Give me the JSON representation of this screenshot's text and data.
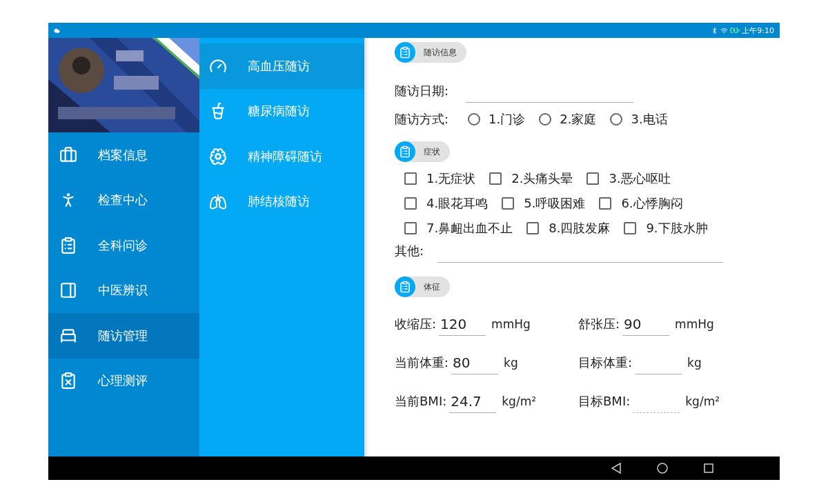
{
  "status_bar": {
    "time": "上午9:10"
  },
  "sidebar": {
    "items": [
      {
        "label": "档案信息",
        "selected": false
      },
      {
        "label": "检查中心",
        "selected": false
      },
      {
        "label": "全科问诊",
        "selected": false
      },
      {
        "label": "中医辨识",
        "selected": false
      },
      {
        "label": "随访管理",
        "selected": true
      },
      {
        "label": "心理测评",
        "selected": false
      }
    ]
  },
  "submenu": {
    "items": [
      {
        "label": "高血压随访",
        "selected": true
      },
      {
        "label": "糖尿病随访",
        "selected": false
      },
      {
        "label": "精神障碍随访",
        "selected": false
      },
      {
        "label": "肺结核随访",
        "selected": false
      }
    ]
  },
  "form": {
    "sections": [
      {
        "title": "随访信息",
        "kind": "visit",
        "date_label": "随访日期:",
        "method_label": "随访方式:",
        "options": [
          {
            "label": "1.门诊",
            "selected": false
          },
          {
            "label": "2.家庭",
            "selected": false
          },
          {
            "label": "3.电话",
            "selected": false
          }
        ]
      },
      {
        "title": "症状",
        "kind": "symptoms",
        "rows": [
          [
            {
              "label": "1.无症状",
              "checked": false
            },
            {
              "label": "2.头痛头晕",
              "checked": false
            },
            {
              "label": "3.恶心呕吐",
              "checked": false
            }
          ],
          [
            {
              "label": "4.眼花耳鸣",
              "checked": false
            },
            {
              "label": "5.呼吸困难",
              "checked": false
            },
            {
              "label": "6.心悸胸闷",
              "checked": false
            }
          ],
          [
            {
              "label": "7.鼻衄出血不止",
              "checked": false
            },
            {
              "label": "8.四肢发麻",
              "checked": false
            },
            {
              "label": "9.下肢水肿",
              "checked": false
            }
          ]
        ],
        "other_label": "其他:"
      },
      {
        "title": "体征",
        "kind": "vitals",
        "rows": [
          [
            {
              "label": "收缩压:",
              "value": "120",
              "unit": "mmHg",
              "disabled": false
            },
            {
              "label": "舒张压:",
              "value": "90",
              "unit": "mmHg",
              "disabled": false
            }
          ],
          [
            {
              "label": "当前体重:",
              "value": "80",
              "unit": "kg",
              "disabled": false
            },
            {
              "label": "目标体重:",
              "unit": "kg",
              "disabled": false
            }
          ],
          [
            {
              "label": "当前BMI:",
              "value": "24.7",
              "unit": "kg/m²",
              "disabled": false
            },
            {
              "label": "目标BMI:",
              "unit": "kg/m²",
              "disabled": true
            }
          ]
        ]
      }
    ]
  }
}
